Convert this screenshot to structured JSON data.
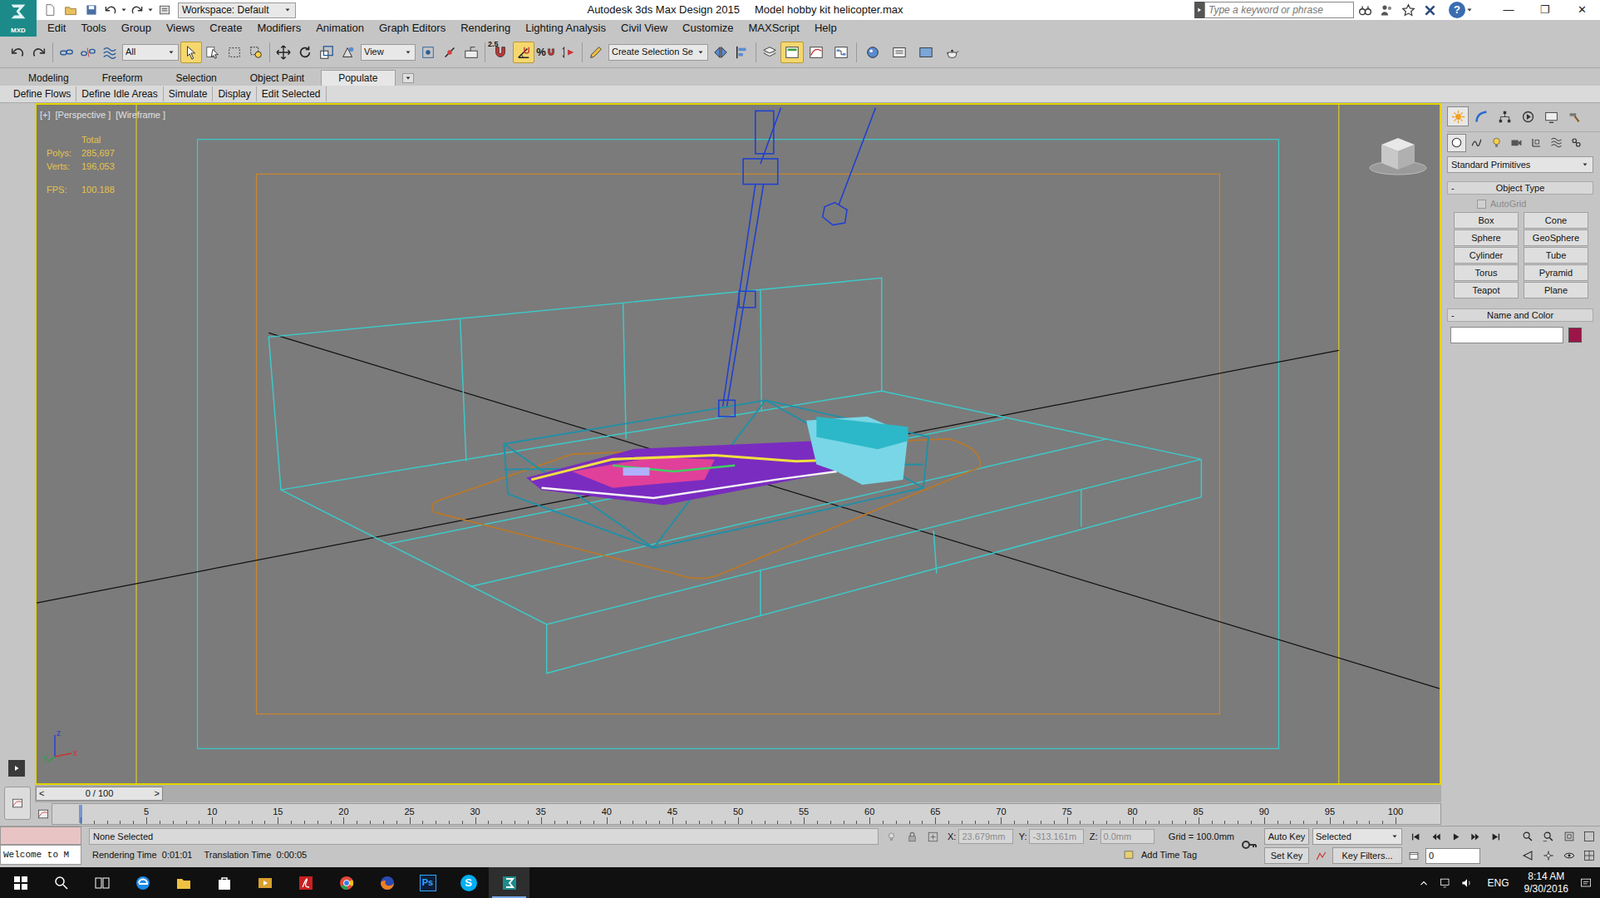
{
  "app": {
    "badge": "MXD"
  },
  "window": {
    "title": "Autodesk 3ds Max Design 2015",
    "file": "Model hobby kit helicopter.max",
    "controls": [
      "—",
      "❐",
      "✕"
    ]
  },
  "quick_access": {
    "workspace": "Workspace: Default"
  },
  "infocenter": {
    "search_placeholder": "Type a keyword or phrase",
    "help": "?"
  },
  "menu": [
    "Edit",
    "Tools",
    "Group",
    "Views",
    "Create",
    "Modifiers",
    "Animation",
    "Graph Editors",
    "Rendering",
    "Lighting Analysis",
    "Civil View",
    "Customize",
    "MAXScript",
    "Help"
  ],
  "toolbar": {
    "selection_filter": "All",
    "reference_coordinate": "View",
    "snap": "2.5",
    "percent_snap": "%",
    "named_selection": "Create Selection Se",
    "toggles": {
      "select_object": true,
      "angle_snap": true,
      "graphite": true
    }
  },
  "ribbon": {
    "tabs": [
      {
        "label": "Modeling",
        "selected": false
      },
      {
        "label": "Freeform",
        "selected": false
      },
      {
        "label": "Selection",
        "selected": false
      },
      {
        "label": "Object Paint",
        "selected": false
      },
      {
        "label": "Populate",
        "selected": true
      }
    ],
    "panels": [
      "Define Flows",
      "Define Idle Areas",
      "Simulate",
      "Display",
      "Edit Selected"
    ]
  },
  "viewport": {
    "active": true,
    "labels": [
      "[+]",
      "[Perspective ]",
      "[Wireframe ]"
    ],
    "stats": {
      "header": "Total",
      "rows": [
        {
          "label": "Polys:",
          "value": "285,697"
        },
        {
          "label": "Verts:",
          "value": "196,053"
        }
      ],
      "fps_label": "FPS:",
      "fps": "100.188"
    },
    "axes": [
      {
        "label": "z",
        "color": "#2a3fd0"
      },
      {
        "label": "x",
        "color": "#d03030"
      },
      {
        "label": "y",
        "color": "#2aa040"
      }
    ]
  },
  "command_panel": {
    "tabs": [
      {
        "selected": true
      },
      {
        "selected": false
      },
      {
        "selected": false
      },
      {
        "selected": false
      },
      {
        "selected": false
      },
      {
        "selected": false
      }
    ],
    "subtabs": [
      {
        "selected": true
      },
      {
        "selected": false
      },
      {
        "selected": false
      },
      {
        "selected": false
      },
      {
        "selected": false
      },
      {
        "selected": false
      },
      {
        "selected": false
      }
    ],
    "category": "Standard Primitives",
    "object_type": {
      "collapse": "-",
      "title": "Object Type",
      "autogrid": {
        "label": "AutoGrid",
        "checked": false,
        "disabled": true
      },
      "buttons": [
        "Box",
        "Cone",
        "Sphere",
        "GeoSphere",
        "Cylinder",
        "Tube",
        "Torus",
        "Pyramid",
        "Teapot",
        "Plane"
      ]
    },
    "name_and_color": {
      "collapse": "-",
      "title": "Name and Color",
      "name": "",
      "color": "#9c1548"
    }
  },
  "time_slider": {
    "prev": "<",
    "label": "0 / 100",
    "next": ">"
  },
  "track_bar": {
    "labels": [
      "5",
      "10",
      "15",
      "20",
      "25",
      "30",
      "35",
      "40",
      "45",
      "50",
      "55",
      "60",
      "65",
      "70",
      "75",
      "80",
      "85",
      "90",
      "95",
      "100"
    ]
  },
  "status": {
    "listener": "Welcome to M",
    "prompt": "None Selected",
    "rendering_time": "Rendering Time  0:01:01",
    "translation_time": "Translation Time  0:00:05",
    "coords": [
      {
        "label": "X:",
        "value": "23.679mm"
      },
      {
        "label": "Y:",
        "value": "-313.161m"
      },
      {
        "label": "Z:",
        "value": "0.0mm"
      }
    ],
    "grid": "Grid = 100.0mm",
    "add_time_tag": "Add Time Tag",
    "auto_key": {
      "label": "Auto Key",
      "on": false
    },
    "key_mode": "Selected",
    "set_key": "Set Key",
    "key_filters": "Key Filters...",
    "frame": "0"
  },
  "taskbar": {
    "buttons": [
      {
        "kind": "start",
        "active": false
      },
      {
        "kind": "search",
        "active": false
      },
      {
        "kind": "taskview",
        "active": false
      },
      {
        "kind": "edge",
        "active": false
      },
      {
        "kind": "explorer",
        "active": false
      },
      {
        "kind": "store",
        "active": false
      },
      {
        "kind": "media",
        "active": false
      },
      {
        "kind": "acrobat",
        "active": false
      },
      {
        "kind": "chrome",
        "active": false
      },
      {
        "kind": "firefox",
        "active": false
      },
      {
        "kind": "photoshop",
        "active": false,
        "label": "Ps"
      },
      {
        "kind": "skype",
        "active": false,
        "label": "S"
      },
      {
        "kind": "max",
        "active": true
      }
    ],
    "lang": "ENG",
    "time": "8:14 AM",
    "date": "9/30/2016"
  }
}
